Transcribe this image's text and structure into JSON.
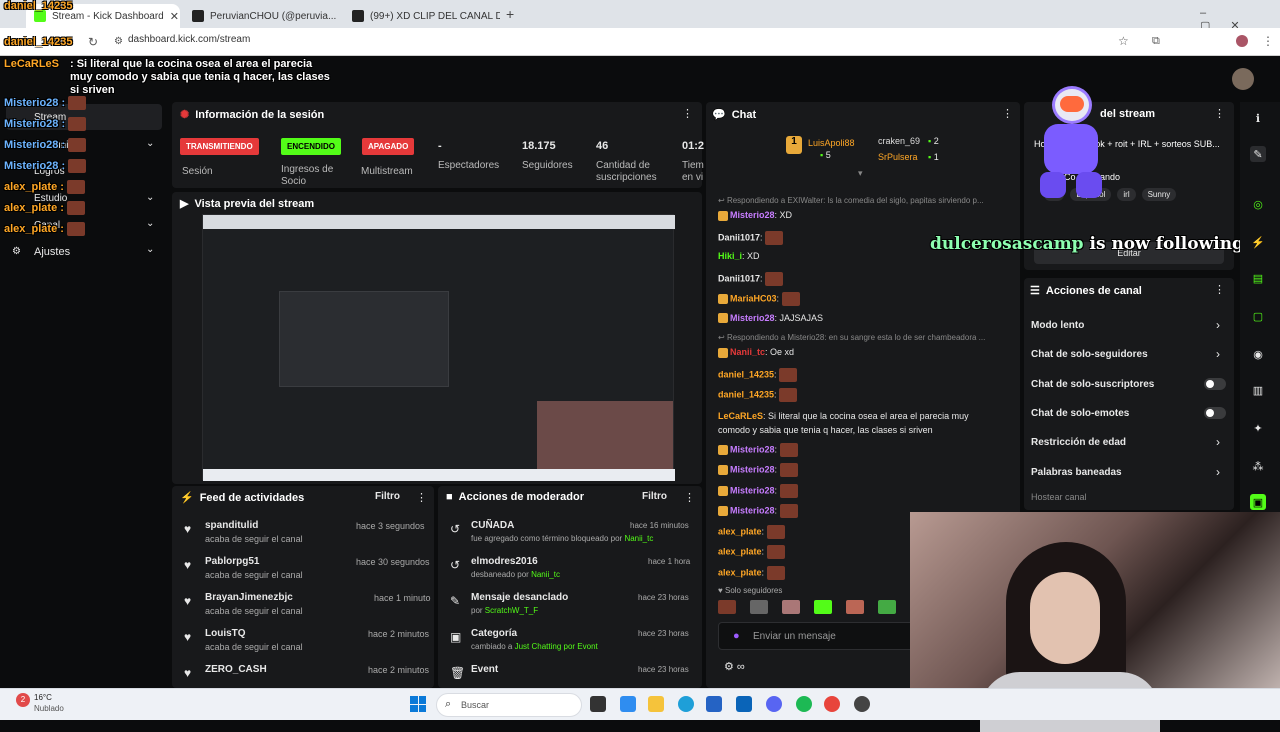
{
  "browser": {
    "tabs": [
      {
        "label": "Stream - Kick Dashboard"
      },
      {
        "label": "PeruvianCHOU (@peruvia..."
      },
      {
        "label": "(99+) XD CLIP DEL CANAL DE"
      }
    ],
    "url": "dashboard.kick.com/stream"
  },
  "overlay_top": {
    "sender_a": "daniel_14235",
    "sender_b": "daniel_14235",
    "sender_c": "LeCaRLeS",
    "message": ": Si literal que la cocina osea el area el parecia muy comodo y sabia que tenia q hacer, las clases si sriven"
  },
  "overlay_left": [
    {
      "name": "Misterio28",
      "sep": ":"
    },
    {
      "name": "Misterio28",
      "sep": ":"
    },
    {
      "name": "Misterio28",
      "sep": ":"
    },
    {
      "name": "Misterio28",
      "sep": ":"
    },
    {
      "name": "alex_plate",
      "sep": ":"
    },
    {
      "name": "alex_plate",
      "sep": ":"
    },
    {
      "name": "alex_plate",
      "sep": ":"
    }
  ],
  "sidebar": {
    "items": [
      {
        "label": "Stream"
      },
      {
        "label": "Comunidad"
      },
      {
        "label": "Logros"
      },
      {
        "label": "Estudio"
      },
      {
        "label": "Canal"
      },
      {
        "label": "Ajustes"
      }
    ]
  },
  "session": {
    "title": "Información de la sesión",
    "stats": [
      {
        "value": "TRANSMITIENDO",
        "label": "Sesión",
        "color": "#e5393a"
      },
      {
        "value": "ENCENDIDO",
        "label": "Ingresos de Socio",
        "color": "#53fc18"
      },
      {
        "value": "APAGADO",
        "label": "Multistream",
        "color": "#e5393a"
      },
      {
        "value": "-",
        "label": "Espectadores"
      },
      {
        "value": "18.175",
        "label": "Seguidores"
      },
      {
        "value": "46",
        "label": "Cantidad de suscripciones"
      },
      {
        "value": "01:2",
        "label": "Tiem en vi"
      }
    ]
  },
  "preview": {
    "title": "Vista previa del stream"
  },
  "activity": {
    "title": "Feed de actividades",
    "filter": "Filtro",
    "items": [
      {
        "name": "spanditulid",
        "desc": "acaba de seguir el canal",
        "time": "hace 3 segundos"
      },
      {
        "name": "Pablorpg51",
        "desc": "acaba de seguir el canal",
        "time": "hace 30 segundos"
      },
      {
        "name": "BrayanJimenezbjc",
        "desc": "acaba de seguir el canal",
        "time": "hace 1 minuto"
      },
      {
        "name": "LouisTQ",
        "desc": "acaba de seguir el canal",
        "time": "hace 2 minutos"
      },
      {
        "name": "ZERO_CASH",
        "desc": "acaba de seguir el canal",
        "time": "hace 2 minutos"
      }
    ]
  },
  "modactions": {
    "title": "Acciones de moderador",
    "filter": "Filtro",
    "items": [
      {
        "name": "CUÑADA",
        "desc": "fue agregado como término bloqueado por",
        "by": "Nanii_tc",
        "time": "hace 16 minutos"
      },
      {
        "name": "elmodres2016",
        "desc": "desbaneado por",
        "by": "Nanii_tc",
        "time": "hace 1 hora"
      },
      {
        "name": "Mensaje desanclado",
        "desc": "por",
        "by": "ScratchW_T_F",
        "time": "hace 23 horas"
      },
      {
        "name": "Categoría",
        "desc": "cambiado a",
        "by": "Just Chatting por Evont",
        "time": "hace 23 horas"
      },
      {
        "name": "Event",
        "desc": "",
        "by": "",
        "time": "hace 23 horas"
      }
    ]
  },
  "chat": {
    "title": "Chat",
    "top_gifters": [
      {
        "name": "LuisApoli88",
        "count": "5"
      },
      {
        "name": "craken_69",
        "count": "2"
      },
      {
        "name": "SrPulsera",
        "count": "1"
      }
    ],
    "lines": [
      {
        "type": "reply",
        "text": "Respondiendo a EXIWalter: ls la comedia del siglo, papitas sirviendo p..."
      },
      {
        "user": "Misterio28",
        "msg": "XD",
        "color": "#c77dff"
      },
      {
        "user": "Danii1017",
        "msg": "",
        "color": "#e8e8e8",
        "emote": true
      },
      {
        "user": "Hiki_i",
        "msg": "XD",
        "color": "#53fc18"
      },
      {
        "user": "Danii1017",
        "msg": "",
        "color": "#e8e8e8",
        "emote": true
      },
      {
        "user": "MariaHC03",
        "msg": "",
        "color": "#ffa726",
        "emote": true
      },
      {
        "user": "Misterio28",
        "msg": "JAJSAJAS",
        "color": "#c77dff"
      },
      {
        "type": "reply",
        "text": "Respondiendo a Misterio28: en su sangre esta lo de ser chambeadora ..."
      },
      {
        "user": "Nanii_tc",
        "msg": "Oe xd",
        "color": "#e5393a"
      },
      {
        "user": "daniel_14235",
        "msg": "",
        "color": "#ffa726",
        "emote": true
      },
      {
        "user": "daniel_14235",
        "msg": "",
        "color": "#ffa726",
        "emote": true
      },
      {
        "user": "LeCaRLeS",
        "msg": "Si literal que la cocina osea el area el parecia muy comodo y sabia que tenia q hacer, las clases si sriven",
        "color": "#ffa726"
      },
      {
        "user": "Misterio28",
        "msg": "",
        "color": "#c77dff",
        "emote": true
      },
      {
        "user": "Misterio28",
        "msg": "",
        "color": "#c77dff",
        "emote": true
      },
      {
        "user": "Misterio28",
        "msg": "",
        "color": "#c77dff",
        "emote": true
      },
      {
        "user": "Misterio28",
        "msg": "",
        "color": "#c77dff",
        "emote": true
      },
      {
        "user": "alex_plate",
        "msg": "",
        "color": "#ffa726",
        "emote": true
      },
      {
        "user": "alex_plate",
        "msg": "",
        "color": "#ffa726",
        "emote": true
      },
      {
        "user": "alex_plate",
        "msg": "",
        "color": "#ffa726",
        "emote": true
      }
    ],
    "followers_only": "Solo seguidores",
    "placeholder": "Enviar un mensaje"
  },
  "stream_info": {
    "title": "del stream",
    "text": "Hoy valo + TikTok + roit + IRL + sorteos SUB...",
    "chat_label": "Co",
    "chat_label2": "ando",
    "tags": [
      "sh",
      "Español",
      "irl",
      "Sunny"
    ],
    "edit": "Editar"
  },
  "follow_alert": {
    "user": "dulcerosascamp",
    "text": " is now following!"
  },
  "channel_actions": {
    "title": "Acciones de canal",
    "items": [
      {
        "label": "Modo lento",
        "control": "arrow"
      },
      {
        "label": "Chat de solo-seguidores",
        "control": "arrow"
      },
      {
        "label": "Chat de solo-suscriptores",
        "control": "toggle"
      },
      {
        "label": "Chat de solo-emotes",
        "control": "toggle"
      },
      {
        "label": "Restricción de edad",
        "control": "arrow"
      },
      {
        "label": "Palabras baneadas",
        "control": "arrow"
      }
    ],
    "host": "Hostear canal"
  },
  "taskbar": {
    "weather_temp": "16°C",
    "weather_desc": "Nublado",
    "search": "Buscar"
  },
  "colors": {
    "accent": "#53fc18",
    "bg": "#0b0c0d",
    "panel": "#18191b",
    "live": "#e5393a"
  }
}
